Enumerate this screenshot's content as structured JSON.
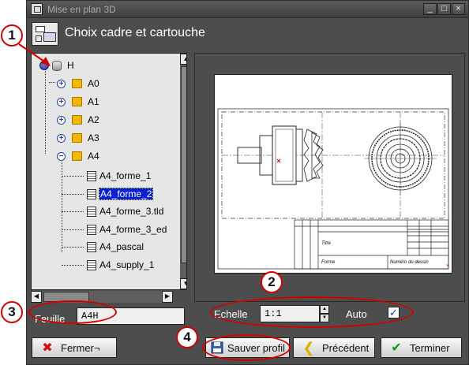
{
  "window": {
    "title": "Mise en plan 3D",
    "controls": [
      "_",
      "□",
      "×"
    ]
  },
  "header": {
    "title": "Choix cadre et cartouche"
  },
  "tree": {
    "root": "H",
    "folders": [
      "A0",
      "A1",
      "A2",
      "A3",
      "A4"
    ],
    "expanded_folder": "A4",
    "items": [
      "A4_forme_1",
      "A4_forme_2",
      "A4_forme_3.tld",
      "A4_forme_3_ed",
      "A4_pascal",
      "A4_supply_1"
    ],
    "selected": "A4_forme_2"
  },
  "feuille": {
    "label": "Feuille",
    "value": "A4H"
  },
  "preview": {
    "title_label": "Titre",
    "forme_label": "Forme",
    "numero_label": "Numéro du dessin"
  },
  "echelle": {
    "label": "Echelle",
    "value": "1:1"
  },
  "auto": {
    "label": "Auto",
    "checked": true
  },
  "buttons": {
    "fermer": "Fermer¬",
    "sauver": "Sauver profil",
    "precedent": "Précédent",
    "terminer": "Terminer"
  },
  "annotations": [
    "1",
    "2",
    "3",
    "4"
  ],
  "colors": {
    "annotation": "#d40000",
    "selection": "#0a1fd6",
    "window_bg": "#4d4d4d"
  }
}
